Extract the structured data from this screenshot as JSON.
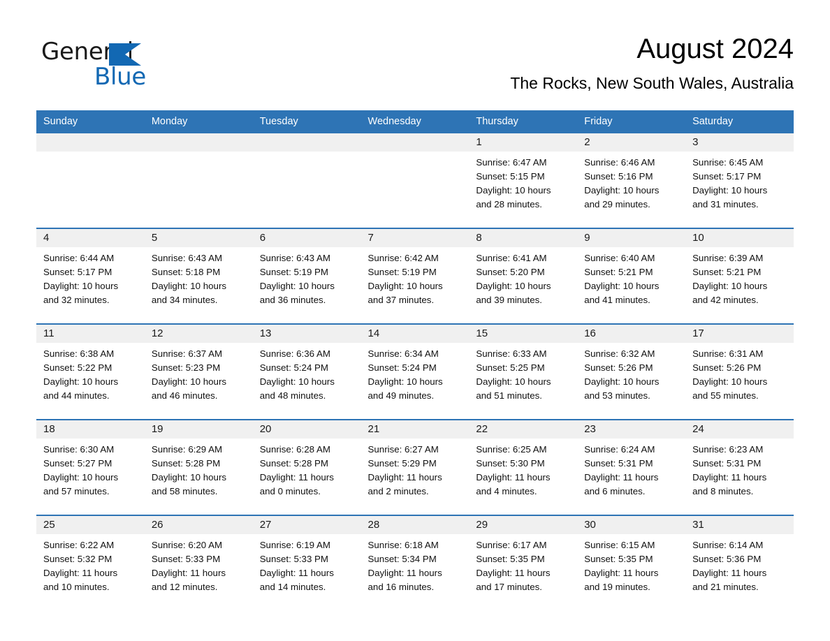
{
  "brand": {
    "name_part1": "General",
    "name_part2": "Blue",
    "triangle_color": "#1268b3",
    "logo_icon": "triangle-icon"
  },
  "header": {
    "title": "August 2024",
    "subtitle": "The Rocks, New South Wales, Australia"
  },
  "theme": {
    "header_blue": "#2e74b5",
    "daynum_band": "#f0f0f0",
    "cell_bg": "#ffffff",
    "text": "#111111"
  },
  "columns": [
    "Sunday",
    "Monday",
    "Tuesday",
    "Wednesday",
    "Thursday",
    "Friday",
    "Saturday"
  ],
  "weeks": [
    [
      {
        "day": "",
        "sunrise": "",
        "sunset": "",
        "daylight1": "",
        "daylight2": ""
      },
      {
        "day": "",
        "sunrise": "",
        "sunset": "",
        "daylight1": "",
        "daylight2": ""
      },
      {
        "day": "",
        "sunrise": "",
        "sunset": "",
        "daylight1": "",
        "daylight2": ""
      },
      {
        "day": "",
        "sunrise": "",
        "sunset": "",
        "daylight1": "",
        "daylight2": ""
      },
      {
        "day": "1",
        "sunrise": "Sunrise: 6:47 AM",
        "sunset": "Sunset: 5:15 PM",
        "daylight1": "Daylight: 10 hours",
        "daylight2": "and 28 minutes."
      },
      {
        "day": "2",
        "sunrise": "Sunrise: 6:46 AM",
        "sunset": "Sunset: 5:16 PM",
        "daylight1": "Daylight: 10 hours",
        "daylight2": "and 29 minutes."
      },
      {
        "day": "3",
        "sunrise": "Sunrise: 6:45 AM",
        "sunset": "Sunset: 5:17 PM",
        "daylight1": "Daylight: 10 hours",
        "daylight2": "and 31 minutes."
      }
    ],
    [
      {
        "day": "4",
        "sunrise": "Sunrise: 6:44 AM",
        "sunset": "Sunset: 5:17 PM",
        "daylight1": "Daylight: 10 hours",
        "daylight2": "and 32 minutes."
      },
      {
        "day": "5",
        "sunrise": "Sunrise: 6:43 AM",
        "sunset": "Sunset: 5:18 PM",
        "daylight1": "Daylight: 10 hours",
        "daylight2": "and 34 minutes."
      },
      {
        "day": "6",
        "sunrise": "Sunrise: 6:43 AM",
        "sunset": "Sunset: 5:19 PM",
        "daylight1": "Daylight: 10 hours",
        "daylight2": "and 36 minutes."
      },
      {
        "day": "7",
        "sunrise": "Sunrise: 6:42 AM",
        "sunset": "Sunset: 5:19 PM",
        "daylight1": "Daylight: 10 hours",
        "daylight2": "and 37 minutes."
      },
      {
        "day": "8",
        "sunrise": "Sunrise: 6:41 AM",
        "sunset": "Sunset: 5:20 PM",
        "daylight1": "Daylight: 10 hours",
        "daylight2": "and 39 minutes."
      },
      {
        "day": "9",
        "sunrise": "Sunrise: 6:40 AM",
        "sunset": "Sunset: 5:21 PM",
        "daylight1": "Daylight: 10 hours",
        "daylight2": "and 41 minutes."
      },
      {
        "day": "10",
        "sunrise": "Sunrise: 6:39 AM",
        "sunset": "Sunset: 5:21 PM",
        "daylight1": "Daylight: 10 hours",
        "daylight2": "and 42 minutes."
      }
    ],
    [
      {
        "day": "11",
        "sunrise": "Sunrise: 6:38 AM",
        "sunset": "Sunset: 5:22 PM",
        "daylight1": "Daylight: 10 hours",
        "daylight2": "and 44 minutes."
      },
      {
        "day": "12",
        "sunrise": "Sunrise: 6:37 AM",
        "sunset": "Sunset: 5:23 PM",
        "daylight1": "Daylight: 10 hours",
        "daylight2": "and 46 minutes."
      },
      {
        "day": "13",
        "sunrise": "Sunrise: 6:36 AM",
        "sunset": "Sunset: 5:24 PM",
        "daylight1": "Daylight: 10 hours",
        "daylight2": "and 48 minutes."
      },
      {
        "day": "14",
        "sunrise": "Sunrise: 6:34 AM",
        "sunset": "Sunset: 5:24 PM",
        "daylight1": "Daylight: 10 hours",
        "daylight2": "and 49 minutes."
      },
      {
        "day": "15",
        "sunrise": "Sunrise: 6:33 AM",
        "sunset": "Sunset: 5:25 PM",
        "daylight1": "Daylight: 10 hours",
        "daylight2": "and 51 minutes."
      },
      {
        "day": "16",
        "sunrise": "Sunrise: 6:32 AM",
        "sunset": "Sunset: 5:26 PM",
        "daylight1": "Daylight: 10 hours",
        "daylight2": "and 53 minutes."
      },
      {
        "day": "17",
        "sunrise": "Sunrise: 6:31 AM",
        "sunset": "Sunset: 5:26 PM",
        "daylight1": "Daylight: 10 hours",
        "daylight2": "and 55 minutes."
      }
    ],
    [
      {
        "day": "18",
        "sunrise": "Sunrise: 6:30 AM",
        "sunset": "Sunset: 5:27 PM",
        "daylight1": "Daylight: 10 hours",
        "daylight2": "and 57 minutes."
      },
      {
        "day": "19",
        "sunrise": "Sunrise: 6:29 AM",
        "sunset": "Sunset: 5:28 PM",
        "daylight1": "Daylight: 10 hours",
        "daylight2": "and 58 minutes."
      },
      {
        "day": "20",
        "sunrise": "Sunrise: 6:28 AM",
        "sunset": "Sunset: 5:28 PM",
        "daylight1": "Daylight: 11 hours",
        "daylight2": "and 0 minutes."
      },
      {
        "day": "21",
        "sunrise": "Sunrise: 6:27 AM",
        "sunset": "Sunset: 5:29 PM",
        "daylight1": "Daylight: 11 hours",
        "daylight2": "and 2 minutes."
      },
      {
        "day": "22",
        "sunrise": "Sunrise: 6:25 AM",
        "sunset": "Sunset: 5:30 PM",
        "daylight1": "Daylight: 11 hours",
        "daylight2": "and 4 minutes."
      },
      {
        "day": "23",
        "sunrise": "Sunrise: 6:24 AM",
        "sunset": "Sunset: 5:31 PM",
        "daylight1": "Daylight: 11 hours",
        "daylight2": "and 6 minutes."
      },
      {
        "day": "24",
        "sunrise": "Sunrise: 6:23 AM",
        "sunset": "Sunset: 5:31 PM",
        "daylight1": "Daylight: 11 hours",
        "daylight2": "and 8 minutes."
      }
    ],
    [
      {
        "day": "25",
        "sunrise": "Sunrise: 6:22 AM",
        "sunset": "Sunset: 5:32 PM",
        "daylight1": "Daylight: 11 hours",
        "daylight2": "and 10 minutes."
      },
      {
        "day": "26",
        "sunrise": "Sunrise: 6:20 AM",
        "sunset": "Sunset: 5:33 PM",
        "daylight1": "Daylight: 11 hours",
        "daylight2": "and 12 minutes."
      },
      {
        "day": "27",
        "sunrise": "Sunrise: 6:19 AM",
        "sunset": "Sunset: 5:33 PM",
        "daylight1": "Daylight: 11 hours",
        "daylight2": "and 14 minutes."
      },
      {
        "day": "28",
        "sunrise": "Sunrise: 6:18 AM",
        "sunset": "Sunset: 5:34 PM",
        "daylight1": "Daylight: 11 hours",
        "daylight2": "and 16 minutes."
      },
      {
        "day": "29",
        "sunrise": "Sunrise: 6:17 AM",
        "sunset": "Sunset: 5:35 PM",
        "daylight1": "Daylight: 11 hours",
        "daylight2": "and 17 minutes."
      },
      {
        "day": "30",
        "sunrise": "Sunrise: 6:15 AM",
        "sunset": "Sunset: 5:35 PM",
        "daylight1": "Daylight: 11 hours",
        "daylight2": "and 19 minutes."
      },
      {
        "day": "31",
        "sunrise": "Sunrise: 6:14 AM",
        "sunset": "Sunset: 5:36 PM",
        "daylight1": "Daylight: 11 hours",
        "daylight2": "and 21 minutes."
      }
    ]
  ]
}
